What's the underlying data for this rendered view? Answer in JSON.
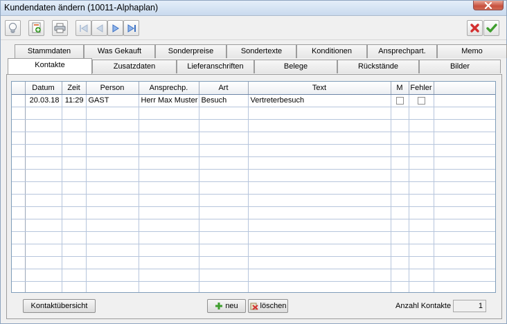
{
  "window": {
    "title": "Kundendaten ändern (10011-Alphaplan)"
  },
  "toolbar": {
    "icons": [
      "lightbulb-icon",
      "add-document-icon",
      "printer-icon",
      "first-record-icon",
      "previous-record-icon",
      "next-record-icon",
      "last-record-icon",
      "cancel-icon",
      "confirm-icon"
    ]
  },
  "tabs": {
    "row1": [
      "Stammdaten",
      "Was Gekauft",
      "Sonderpreise",
      "Sondertexte",
      "Konditionen",
      "Ansprechpart.",
      "Memo"
    ],
    "row2": [
      "Kontakte",
      "Zusatzdaten",
      "Lieferanschriften",
      "Belege",
      "Rückstände",
      "Bilder"
    ],
    "active": "Kontakte"
  },
  "grid": {
    "columns": [
      "Datum",
      "Zeit",
      "Person",
      "Ansprechp.",
      "Art",
      "Text",
      "M",
      "Fehler"
    ],
    "rows": [
      {
        "datum": "20.03.18",
        "zeit": "11:29",
        "person": "GAST",
        "ansprechp": "Herr Max Muster",
        "art": "Besuch",
        "text": "Vertreterbesuch",
        "m": false,
        "fehler": false
      }
    ]
  },
  "footer": {
    "overview_label": "Kontaktübersicht",
    "new_label": "neu",
    "delete_label": "löschen",
    "count_label": "Anzahl Kontakte",
    "count_value": "1"
  },
  "colors": {
    "accent_blue": "#3a7bd5",
    "confirm_green": "#3e9e2e",
    "cancel_red": "#d32f2f"
  }
}
